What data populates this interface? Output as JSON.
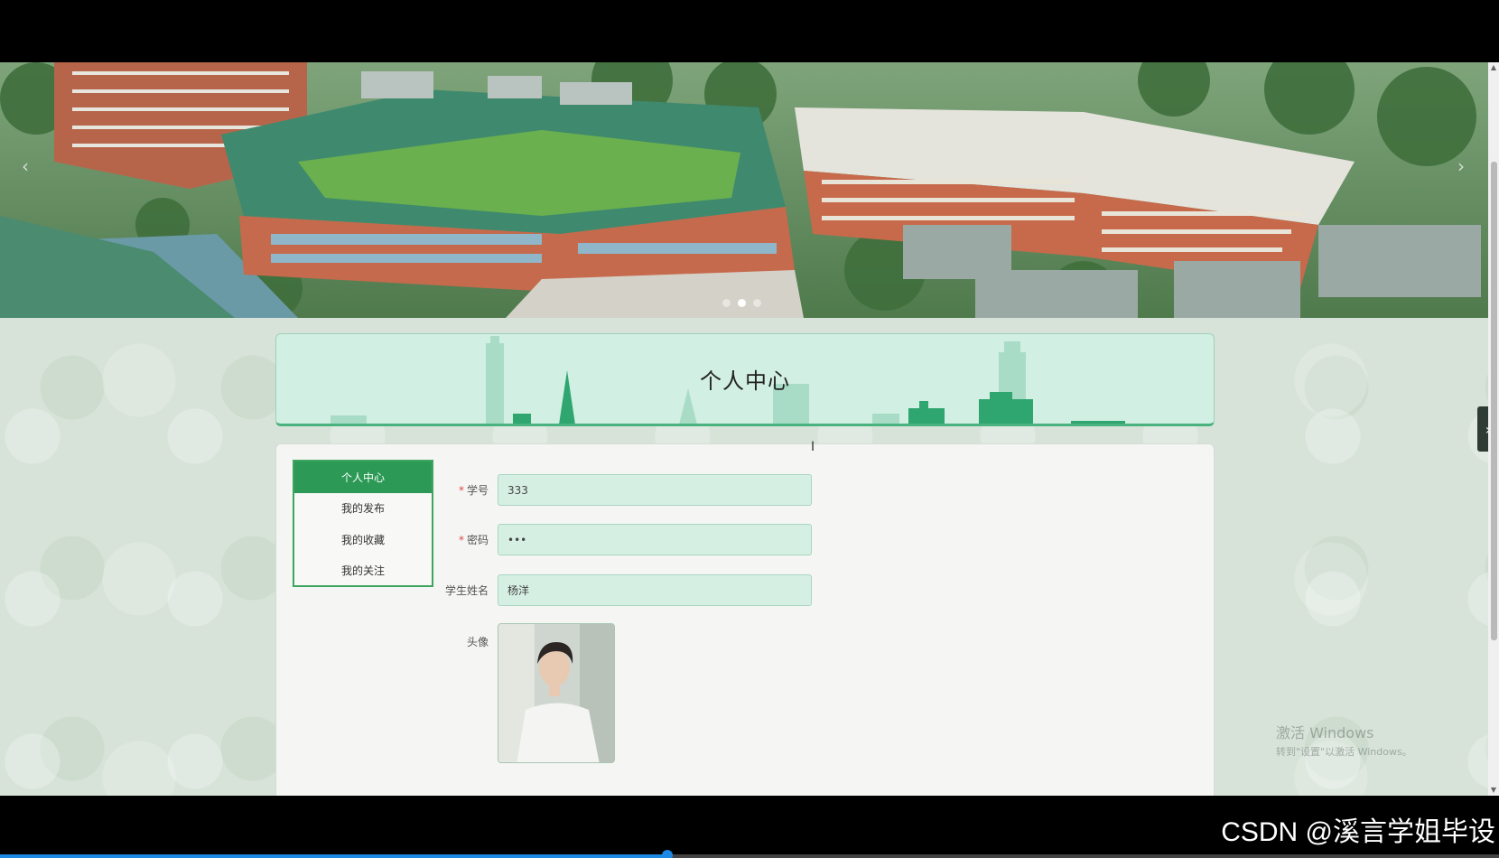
{
  "banner": {
    "slide_count": 3,
    "active_slide": 2
  },
  "page": {
    "title": "个人中心"
  },
  "menu": {
    "items": [
      {
        "label": "个人中心",
        "active": true
      },
      {
        "label": "我的发布",
        "active": false
      },
      {
        "label": "我的收藏",
        "active": false
      },
      {
        "label": "我的关注",
        "active": false
      }
    ]
  },
  "form": {
    "student_id": {
      "label": "学号",
      "required": true,
      "value": "333"
    },
    "password": {
      "label": "密码",
      "required": true,
      "value": "•••"
    },
    "student_name": {
      "label": "学生姓名",
      "required": false,
      "value": "杨洋"
    },
    "avatar": {
      "label": "头像"
    }
  },
  "watermark": {
    "line1": "激活 Windows",
    "line2": "转到\"设置\"以激活 Windows。"
  },
  "overlay": {
    "source_mark": "CSDN @溪言学姐毕设"
  },
  "video": {
    "progress": 0.445
  },
  "colors": {
    "accent_green": "#2c9a56",
    "title_bg": "#d1efe2",
    "input_bg": "#d6efe3",
    "required_star": "#e04848"
  },
  "icons": {
    "prev": "chevron-left-icon",
    "next": "chevron-right-icon",
    "side_toggle": "chevron-right-icon"
  }
}
